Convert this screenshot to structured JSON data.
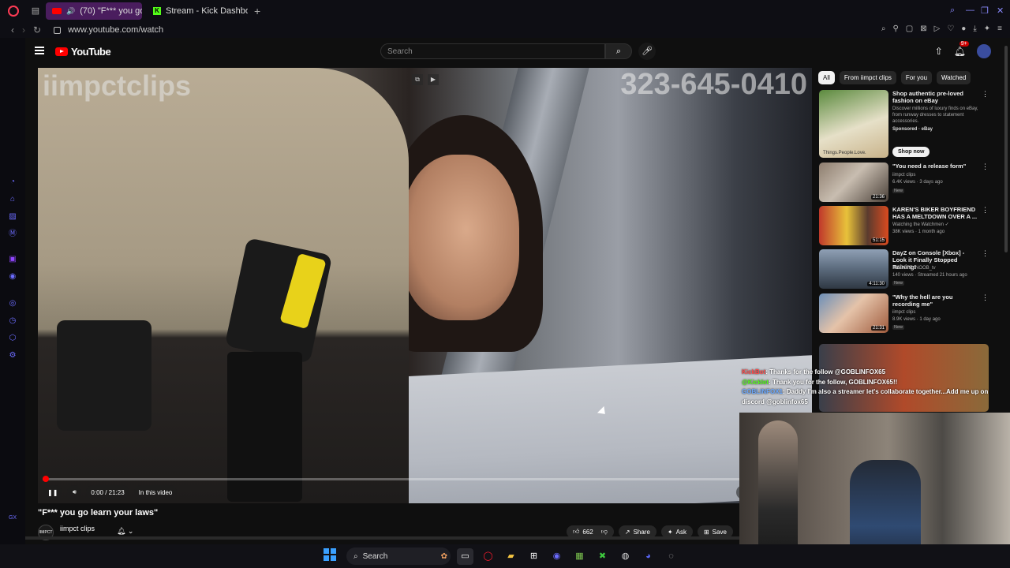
{
  "browser": {
    "tabs": [
      {
        "label": "(70) \"F*** you go learn",
        "active": true
      },
      {
        "label": "Stream - Kick Dashboard",
        "active": false
      }
    ],
    "new_tab": "+",
    "url": "www.youtube.com/watch"
  },
  "youtube": {
    "logo": "YouTube",
    "search_placeholder": "Search",
    "notification_count": "9+",
    "video": {
      "title": "\"F*** you go learn your laws\"",
      "watermark_left": "iimpctclips",
      "watermark_right": "323-645-0410",
      "time": "0:00 / 21:23",
      "chapter": "In this video",
      "progress": 0.0,
      "channel_name": "iimpct clips",
      "channel_avatar_text": "IIMPCT",
      "likes": "662",
      "share_label": "Share",
      "ask_label": "Ask",
      "save_label": "Save"
    },
    "chips": [
      "All",
      "From iimpct clips",
      "For you",
      "Watched"
    ],
    "recommendations": [
      {
        "title": "Shop authentic pre-loved fashion on eBay",
        "meta1": "Discover millions of luxury finds on eBay, from runway dresses to statement accessories.",
        "meta2": "Sponsored · eBay",
        "thumb_caption": "Things.People.Love.",
        "cta": "Shop now",
        "duration": ""
      },
      {
        "title": "\"You need a release form\"",
        "meta1": "iimpct clips",
        "meta2": "6.4K views · 3 days ago",
        "badge": "New",
        "duration": "21:36"
      },
      {
        "title": "KAREN'S BIKER BOYFRIEND HAS A MELTDOWN OVER A ...",
        "meta1": "Watching the Watchmen ✓",
        "meta2": "38K views · 1 month ago",
        "duration": "51:15"
      },
      {
        "title": "DayZ on Console [Xbox] - Look it Finally Stopped Raining!",
        "meta1": "INFECTEdNOOB_tv",
        "meta2": "140 views · Streamed 21 hours ago",
        "badge": "New",
        "duration": "4:11:30"
      },
      {
        "title": "\"Why the hell are you recording me\"",
        "meta1": "iimpct clips",
        "meta2": "8.9K views · 1 day ago",
        "badge": "New",
        "duration": "21:31"
      }
    ]
  },
  "stream_overlay": {
    "chat": [
      {
        "user": "KickBot",
        "text": "Thanks for the follow @GOBLINFOX65"
      },
      {
        "user": "@Kicklet",
        "text": "Thank you for the follow, GOBLINFOX65!!"
      },
      {
        "user": "GOBLINFOX1",
        "text": "Daddy I'm also a streamer let's collaborate together...Add me up on discord @goblinfox65"
      }
    ]
  },
  "taskbar": {
    "search_label": "Search"
  },
  "colors": {
    "tab_active": "#4a1d5e",
    "yt_red": "#ff0000",
    "kick_green": "#53fc18"
  }
}
